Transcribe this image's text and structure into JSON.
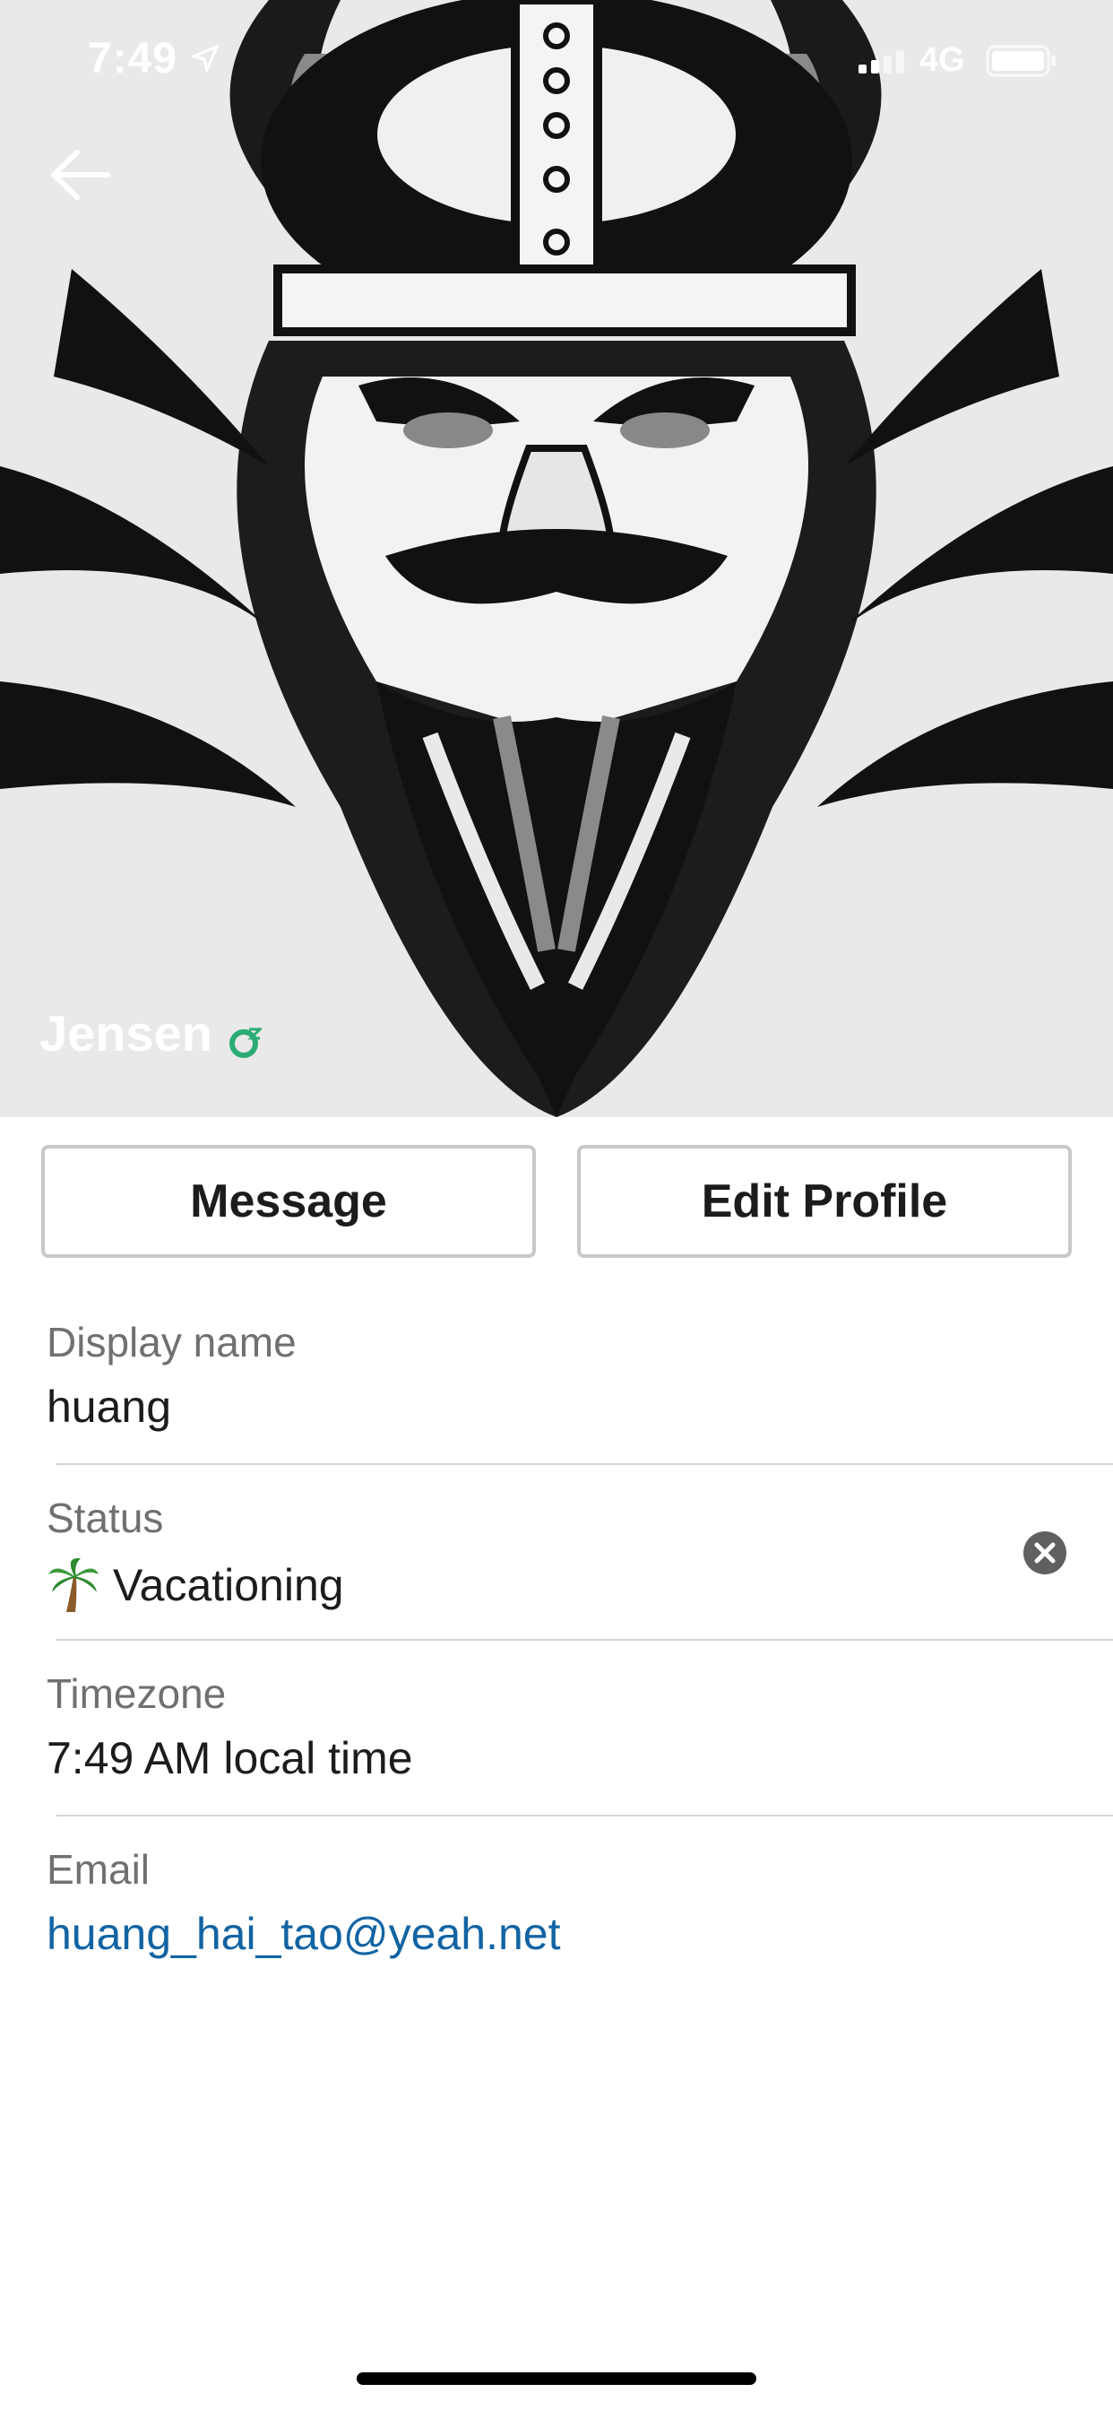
{
  "status_bar": {
    "time": "7:49",
    "network": "4G"
  },
  "profile": {
    "name": "Jensen"
  },
  "actions": {
    "message_label": "Message",
    "edit_profile_label": "Edit Profile"
  },
  "fields": {
    "display_name": {
      "label": "Display name",
      "value": "huang"
    },
    "status": {
      "label": "Status",
      "emoji": "palm-tree-icon",
      "value": "Vacationing"
    },
    "timezone": {
      "label": "Timezone",
      "value": "7:49 AM local time"
    },
    "email": {
      "label": "Email",
      "value": "huang_hai_tao@yeah.net"
    }
  },
  "colors": {
    "link": "#1264a3",
    "presence": "#2bac76"
  },
  "icons": {
    "back": "arrow-left-icon",
    "clear_status": "close-circle-icon",
    "location": "location-arrow-icon",
    "signal": "signal-icon",
    "battery": "battery-icon"
  }
}
